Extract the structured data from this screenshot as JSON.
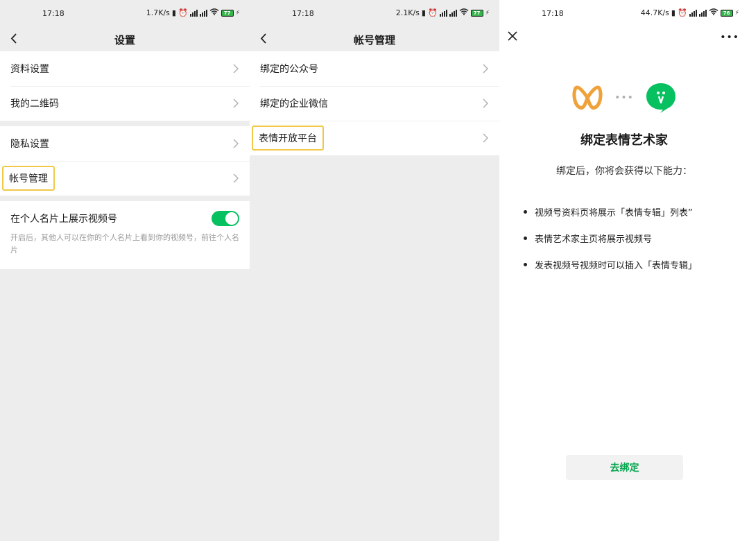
{
  "screens": [
    {
      "status": {
        "time": "17:18",
        "speed": "1.7K/s",
        "battery": "77"
      },
      "title": "设置",
      "groups": [
        [
          "资料设置",
          "我的二维码"
        ],
        [
          "隐私设置",
          "帐号管理"
        ]
      ],
      "toggle": {
        "label": "在个人名片上展示视频号",
        "description": "开启后，其他人可以在你的个人名片上看到你的视频号，前往个人名片"
      }
    },
    {
      "status": {
        "time": "17:18",
        "speed": "2.1K/s",
        "battery": "77"
      },
      "title": "帐号管理",
      "items": [
        "绑定的公众号",
        "绑定的企业微信",
        "表情开放平台"
      ]
    },
    {
      "status": {
        "time": "17:18",
        "speed": "44.7K/s",
        "battery": "76"
      },
      "heading": "绑定表情艺术家",
      "subtitle": "绑定后，你将会获得以下能力：",
      "bullets": [
        "视频号资料页将展示「表情专辑」列表”",
        "表情艺术家主页将展示视频号",
        "发表视频号视频时可以插入「表情专辑」"
      ],
      "button": "去绑定",
      "more": "•••",
      "connector": "•••"
    }
  ],
  "colors": {
    "accent": "#07c160",
    "highlight": "#f1c848",
    "brand_orange": "#f0a23a"
  }
}
